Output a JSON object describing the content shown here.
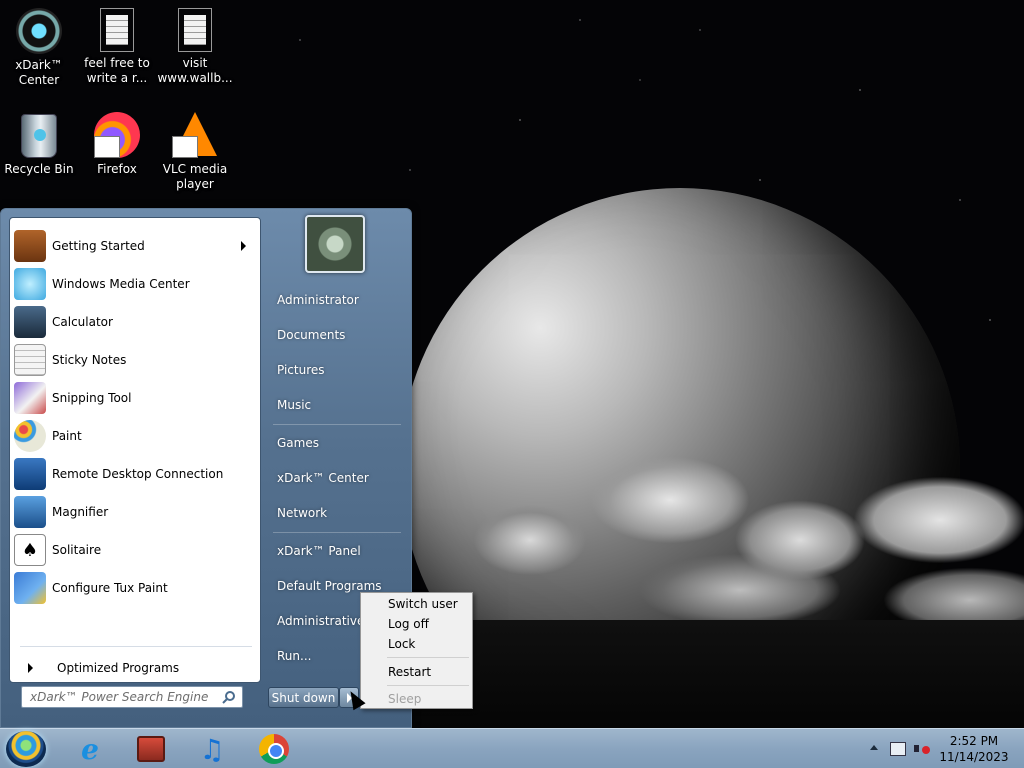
{
  "desktop": {
    "icons": [
      {
        "label": "xDark™ Center",
        "icon": "xdark-center-icon"
      },
      {
        "label": "feel free to write a r...",
        "icon": "text-document-icon"
      },
      {
        "label": "visit www.wallb...",
        "icon": "text-document-icon"
      },
      {
        "label": "Recycle Bin",
        "icon": "recycle-bin-icon"
      },
      {
        "label": "Firefox",
        "icon": "firefox-icon"
      },
      {
        "label": "VLC media player",
        "icon": "vlc-icon"
      }
    ]
  },
  "start_menu": {
    "programs": [
      {
        "label": "Getting Started",
        "icon": "getting-started-icon",
        "has_submenu": true
      },
      {
        "label": "Windows Media Center",
        "icon": "media-center-icon"
      },
      {
        "label": "Calculator",
        "icon": "calculator-icon"
      },
      {
        "label": "Sticky Notes",
        "icon": "sticky-notes-icon"
      },
      {
        "label": "Snipping Tool",
        "icon": "snipping-tool-icon"
      },
      {
        "label": "Paint",
        "icon": "paint-icon"
      },
      {
        "label": "Remote Desktop Connection",
        "icon": "remote-desktop-icon"
      },
      {
        "label": "Magnifier",
        "icon": "magnifier-icon"
      },
      {
        "label": "Solitaire",
        "icon": "solitaire-icon"
      },
      {
        "label": "Configure Tux Paint",
        "icon": "tux-paint-icon"
      }
    ],
    "all_programs_label": "Optimized Programs",
    "search_placeholder": "xDark™ Power Search Engine",
    "right_items": [
      "Administrator",
      "Documents",
      "Pictures",
      "Music",
      "Games",
      "xDark™ Center",
      "Network",
      "xDark™ Panel",
      "Default Programs",
      "Administrative Tools",
      "Run..."
    ],
    "shutdown_label": "Shut down"
  },
  "shutdown_menu": {
    "items": [
      {
        "label": "Switch user",
        "enabled": true
      },
      {
        "label": "Log off",
        "enabled": true
      },
      {
        "label": "Lock",
        "enabled": true
      },
      {
        "label": "Restart",
        "enabled": true
      },
      {
        "label": "Sleep",
        "enabled": false
      }
    ]
  },
  "taskbar": {
    "pinned": [
      "internet-explorer-icon",
      "store-icon",
      "itunes-icon",
      "chrome-icon"
    ],
    "clock_time": "2:52 PM",
    "clock_date": "11/14/2023"
  }
}
